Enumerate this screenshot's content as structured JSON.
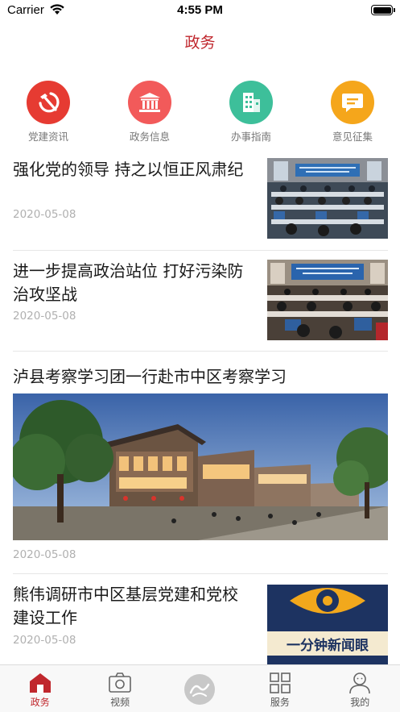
{
  "status_bar": {
    "carrier": "Carrier",
    "time": "4:55 PM"
  },
  "nav": {
    "title": "政务"
  },
  "shortcuts": [
    {
      "label": "党建资讯",
      "icon": "hammer-sickle-icon",
      "color": "#e63b32"
    },
    {
      "label": "政务信息",
      "icon": "government-building-icon",
      "color": "#f25a5a"
    },
    {
      "label": "办事指南",
      "icon": "office-building-icon",
      "color": "#3dbf9a"
    },
    {
      "label": "意见征集",
      "icon": "comment-icon",
      "color": "#f5a61b"
    }
  ],
  "articles": [
    {
      "title": "强化党的领导 持之以恒正风肃纪",
      "date": "2020-05-08"
    },
    {
      "title": "进一步提高政治站位 打好污染防治攻坚战",
      "date": "2020-05-08"
    },
    {
      "title": "泸县考察学习团一行赴市中区考察学习",
      "date": "2020-05-08"
    },
    {
      "title": "熊伟调研市中区基层党建和党校建设工作",
      "date": "2020-05-08",
      "thumb_text": "一分钟新闻眼"
    }
  ],
  "tabbar": [
    {
      "label": "政务",
      "icon": "home-icon",
      "active": true
    },
    {
      "label": "视频",
      "icon": "camera-icon",
      "active": false
    },
    {
      "label": "",
      "icon": "center-logo-icon",
      "active": false
    },
    {
      "label": "服务",
      "icon": "grid-icon",
      "active": false
    },
    {
      "label": "我的",
      "icon": "user-icon",
      "active": false
    }
  ],
  "colors": {
    "brand_red": "#c0272d",
    "divider": "#e6e6e6",
    "date_gray": "#b0b0b0"
  }
}
